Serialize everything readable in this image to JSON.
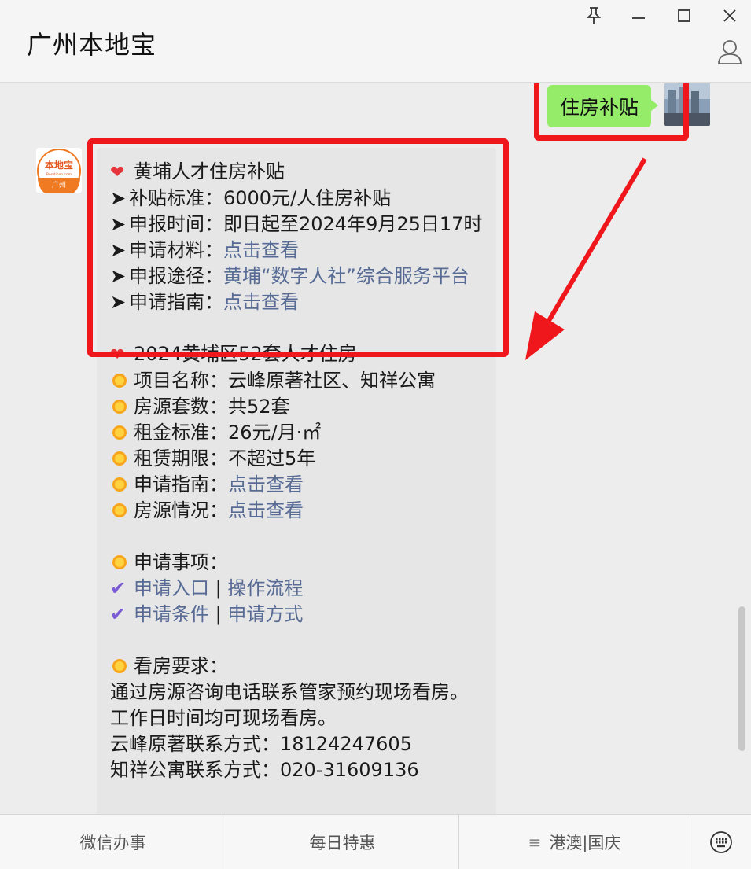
{
  "window": {
    "title": "广州本地宝"
  },
  "chat": {
    "sent_message": "住房补贴",
    "bot_avatar_text": "本地宝",
    "bot_avatar_subtext": "Bendibao.com",
    "bot_avatar_city": "广州",
    "reply": {
      "s1_title": "黄埔人才住房补贴",
      "s1_l1_label": "补贴标准：",
      "s1_l1_value": "6000元/人住房补贴",
      "s1_l2_label": "申报时间：",
      "s1_l2_value": "即日起至2024年9月25日17时",
      "s1_l3_label": "申请材料：",
      "s1_l3_link": "点击查看",
      "s1_l4_label": "申报途径：",
      "s1_l4_link": "黄埔“数字人社”综合服务平台",
      "s1_l5_label": "申请指南：",
      "s1_l5_link": "点击查看",
      "s2_title": "2024黄埔区52套人才住房",
      "s2_l1_label": "项目名称：",
      "s2_l1_value": "云峰原著社区、知祥公寓",
      "s2_l2_label": "房源套数：",
      "s2_l2_value": "共52套",
      "s2_l3_label": "租金标准：",
      "s2_l3_value": "26元/月·㎡",
      "s2_l4_label": "租赁期限：",
      "s2_l4_value": "不超过5年",
      "s2_l5_label": "申请指南：",
      "s2_l5_link": "点击查看",
      "s2_l6_label": "房源情况：",
      "s2_l6_link": "点击查看",
      "s3_title": "申请事项：",
      "s3_link1": "申请入口",
      "s3_sep": " | ",
      "s3_link2": "操作流程",
      "s3_link3": "申请条件",
      "s3_link4": "申请方式",
      "s4_title": "看房要求：",
      "s4_l1": "通过房源咨询电话联系管家预约现场看房。",
      "s4_l2": "工作日时间均可现场看房。",
      "s4_l3": "云峰原著联系方式：18124247605",
      "s4_l4": "知祥公寓联系方式：020-31609136"
    }
  },
  "bottom_menu": {
    "item1": "微信办事",
    "item2": "每日特惠",
    "item3": "港澳|国庆",
    "item3_icon": "menu-lines-icon",
    "keyboard_icon": "keyboard-icon"
  },
  "colors": {
    "sent_bubble": "#95ec69",
    "link": "#576b95",
    "annotation_red": "#f0171c",
    "background": "#ededed"
  }
}
